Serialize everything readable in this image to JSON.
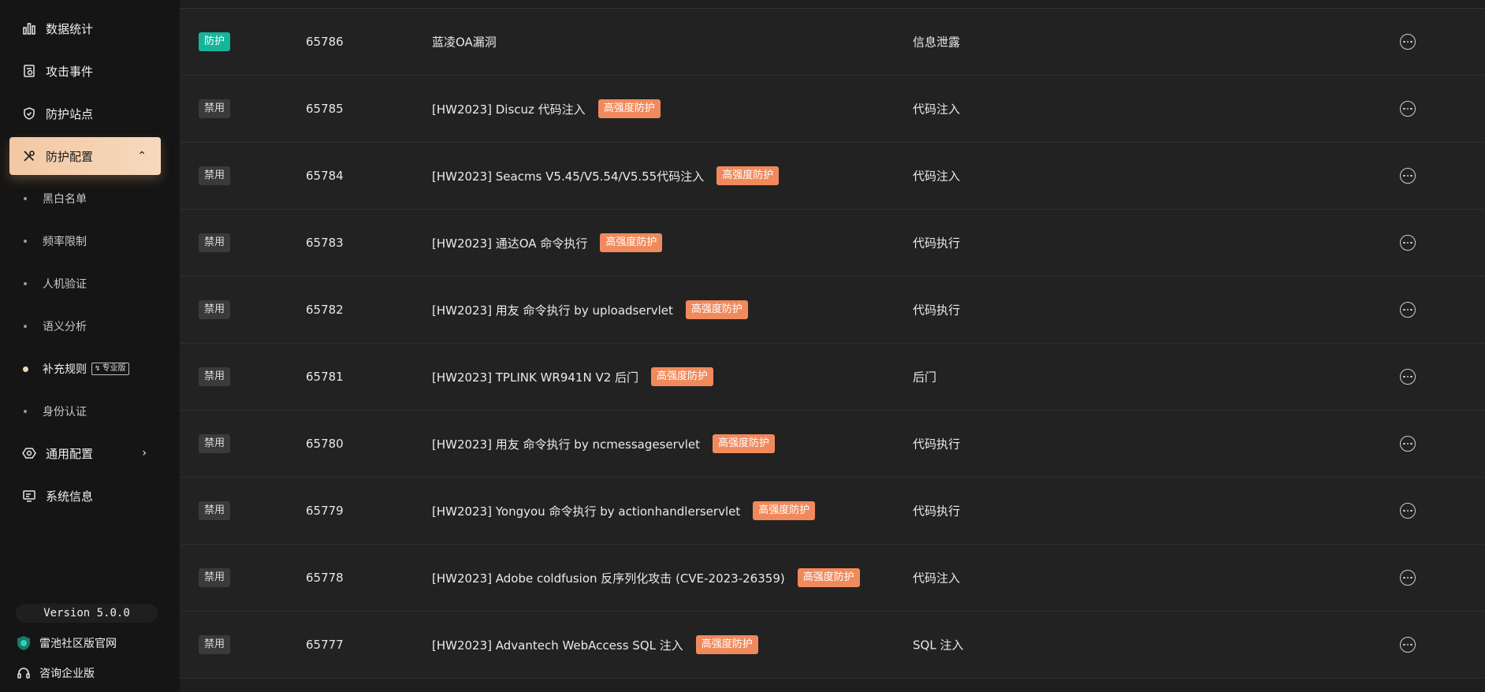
{
  "sidebar": {
    "nav": [
      {
        "label": "数据统计",
        "icon": "bar-chart-icon"
      },
      {
        "label": "攻击事件",
        "icon": "event-log-icon"
      },
      {
        "label": "防护站点",
        "icon": "shield-icon"
      },
      {
        "label": "防护配置",
        "icon": "tools-icon",
        "expanded": true,
        "active": true
      }
    ],
    "sub": [
      {
        "label": "黑白名单"
      },
      {
        "label": "频率限制"
      },
      {
        "label": "人机验证"
      },
      {
        "label": "语义分析"
      },
      {
        "label": "补充规则",
        "badge": "专业版",
        "current": true
      },
      {
        "label": "身份认证"
      }
    ],
    "nav2": [
      {
        "label": "通用配置",
        "icon": "settings-hex-icon"
      },
      {
        "label": "系统信息",
        "icon": "monitor-icon"
      }
    ],
    "version": "Version 5.0.0",
    "links": [
      {
        "label": "雷池社区版官网",
        "icon": "safeline-logo-icon"
      },
      {
        "label": "咨询企业版",
        "icon": "headset-icon"
      }
    ]
  },
  "rules": [
    {
      "status": "防护",
      "status_type": "protect",
      "id": "65786",
      "name": "蓝凌OA漏洞",
      "tag": "",
      "type": "信息泄露"
    },
    {
      "status": "禁用",
      "status_type": "ban",
      "id": "65785",
      "name": "[HW2023] Discuz 代码注入",
      "tag": "高强度防护",
      "type": "代码注入"
    },
    {
      "status": "禁用",
      "status_type": "ban",
      "id": "65784",
      "name": "[HW2023] Seacms V5.45/V5.54/V5.55代码注入",
      "tag": "高强度防护",
      "type": "代码注入"
    },
    {
      "status": "禁用",
      "status_type": "ban",
      "id": "65783",
      "name": "[HW2023] 通达OA 命令执行",
      "tag": "高强度防护",
      "type": "代码执行"
    },
    {
      "status": "禁用",
      "status_type": "ban",
      "id": "65782",
      "name": "[HW2023] 用友 命令执行 by uploadservlet",
      "tag": "高强度防护",
      "type": "代码执行"
    },
    {
      "status": "禁用",
      "status_type": "ban",
      "id": "65781",
      "name": "[HW2023] TPLINK WR941N V2 后门",
      "tag": "高强度防护",
      "type": "后门"
    },
    {
      "status": "禁用",
      "status_type": "ban",
      "id": "65780",
      "name": "[HW2023] 用友 命令执行 by ncmessageservlet",
      "tag": "高强度防护",
      "type": "代码执行"
    },
    {
      "status": "禁用",
      "status_type": "ban",
      "id": "65779",
      "name": "[HW2023] Yongyou 命令执行 by actionhandlerservlet",
      "tag": "高强度防护",
      "type": "代码执行"
    },
    {
      "status": "禁用",
      "status_type": "ban",
      "id": "65778",
      "name": "[HW2023] Adobe coldfusion 反序列化攻击 (CVE-2023-26359)",
      "tag": "高强度防护",
      "type": "代码注入"
    },
    {
      "status": "禁用",
      "status_type": "ban",
      "id": "65777",
      "name": "[HW2023] Advantech WebAccess SQL 注入",
      "tag": "高强度防护",
      "type": "SQL 注入"
    }
  ],
  "colors": {
    "active_nav": "#f3c8a4",
    "protect": "#16b59a",
    "high_tag": "#f08a5d"
  }
}
